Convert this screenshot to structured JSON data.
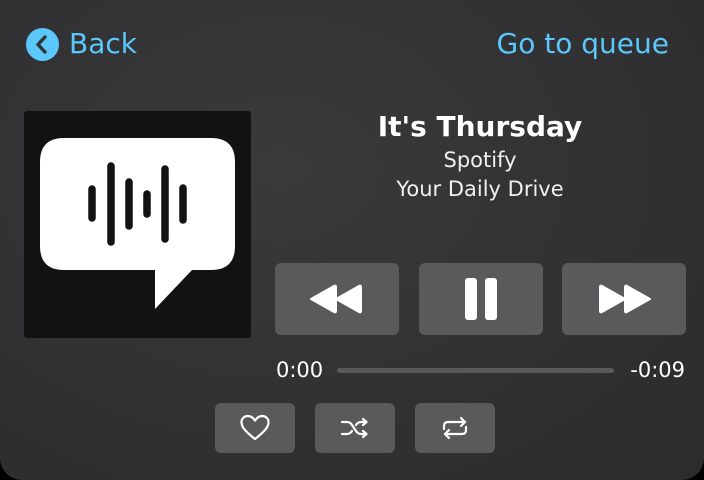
{
  "header": {
    "back_label": "Back",
    "queue_label": "Go to queue"
  },
  "track": {
    "title": "It's Thursday",
    "artist": "Spotify",
    "album": "Your Daily Drive"
  },
  "playback": {
    "elapsed": "0:00",
    "remaining": "-0:09",
    "progress_fraction": 0.0
  },
  "icons": {
    "back": "chevron-left-icon",
    "rewind": "rewind-icon",
    "pause": "pause-icon",
    "forward": "fast-forward-icon",
    "like": "heart-icon",
    "shuffle": "shuffle-icon",
    "repeat": "repeat-icon",
    "artwork": "speech-bubble-waveform-icon"
  },
  "colors": {
    "accent": "#5ac8fa",
    "button_bg": "#5a5a5d",
    "panel_bg": "#333335",
    "artwork_bg": "#121212"
  }
}
